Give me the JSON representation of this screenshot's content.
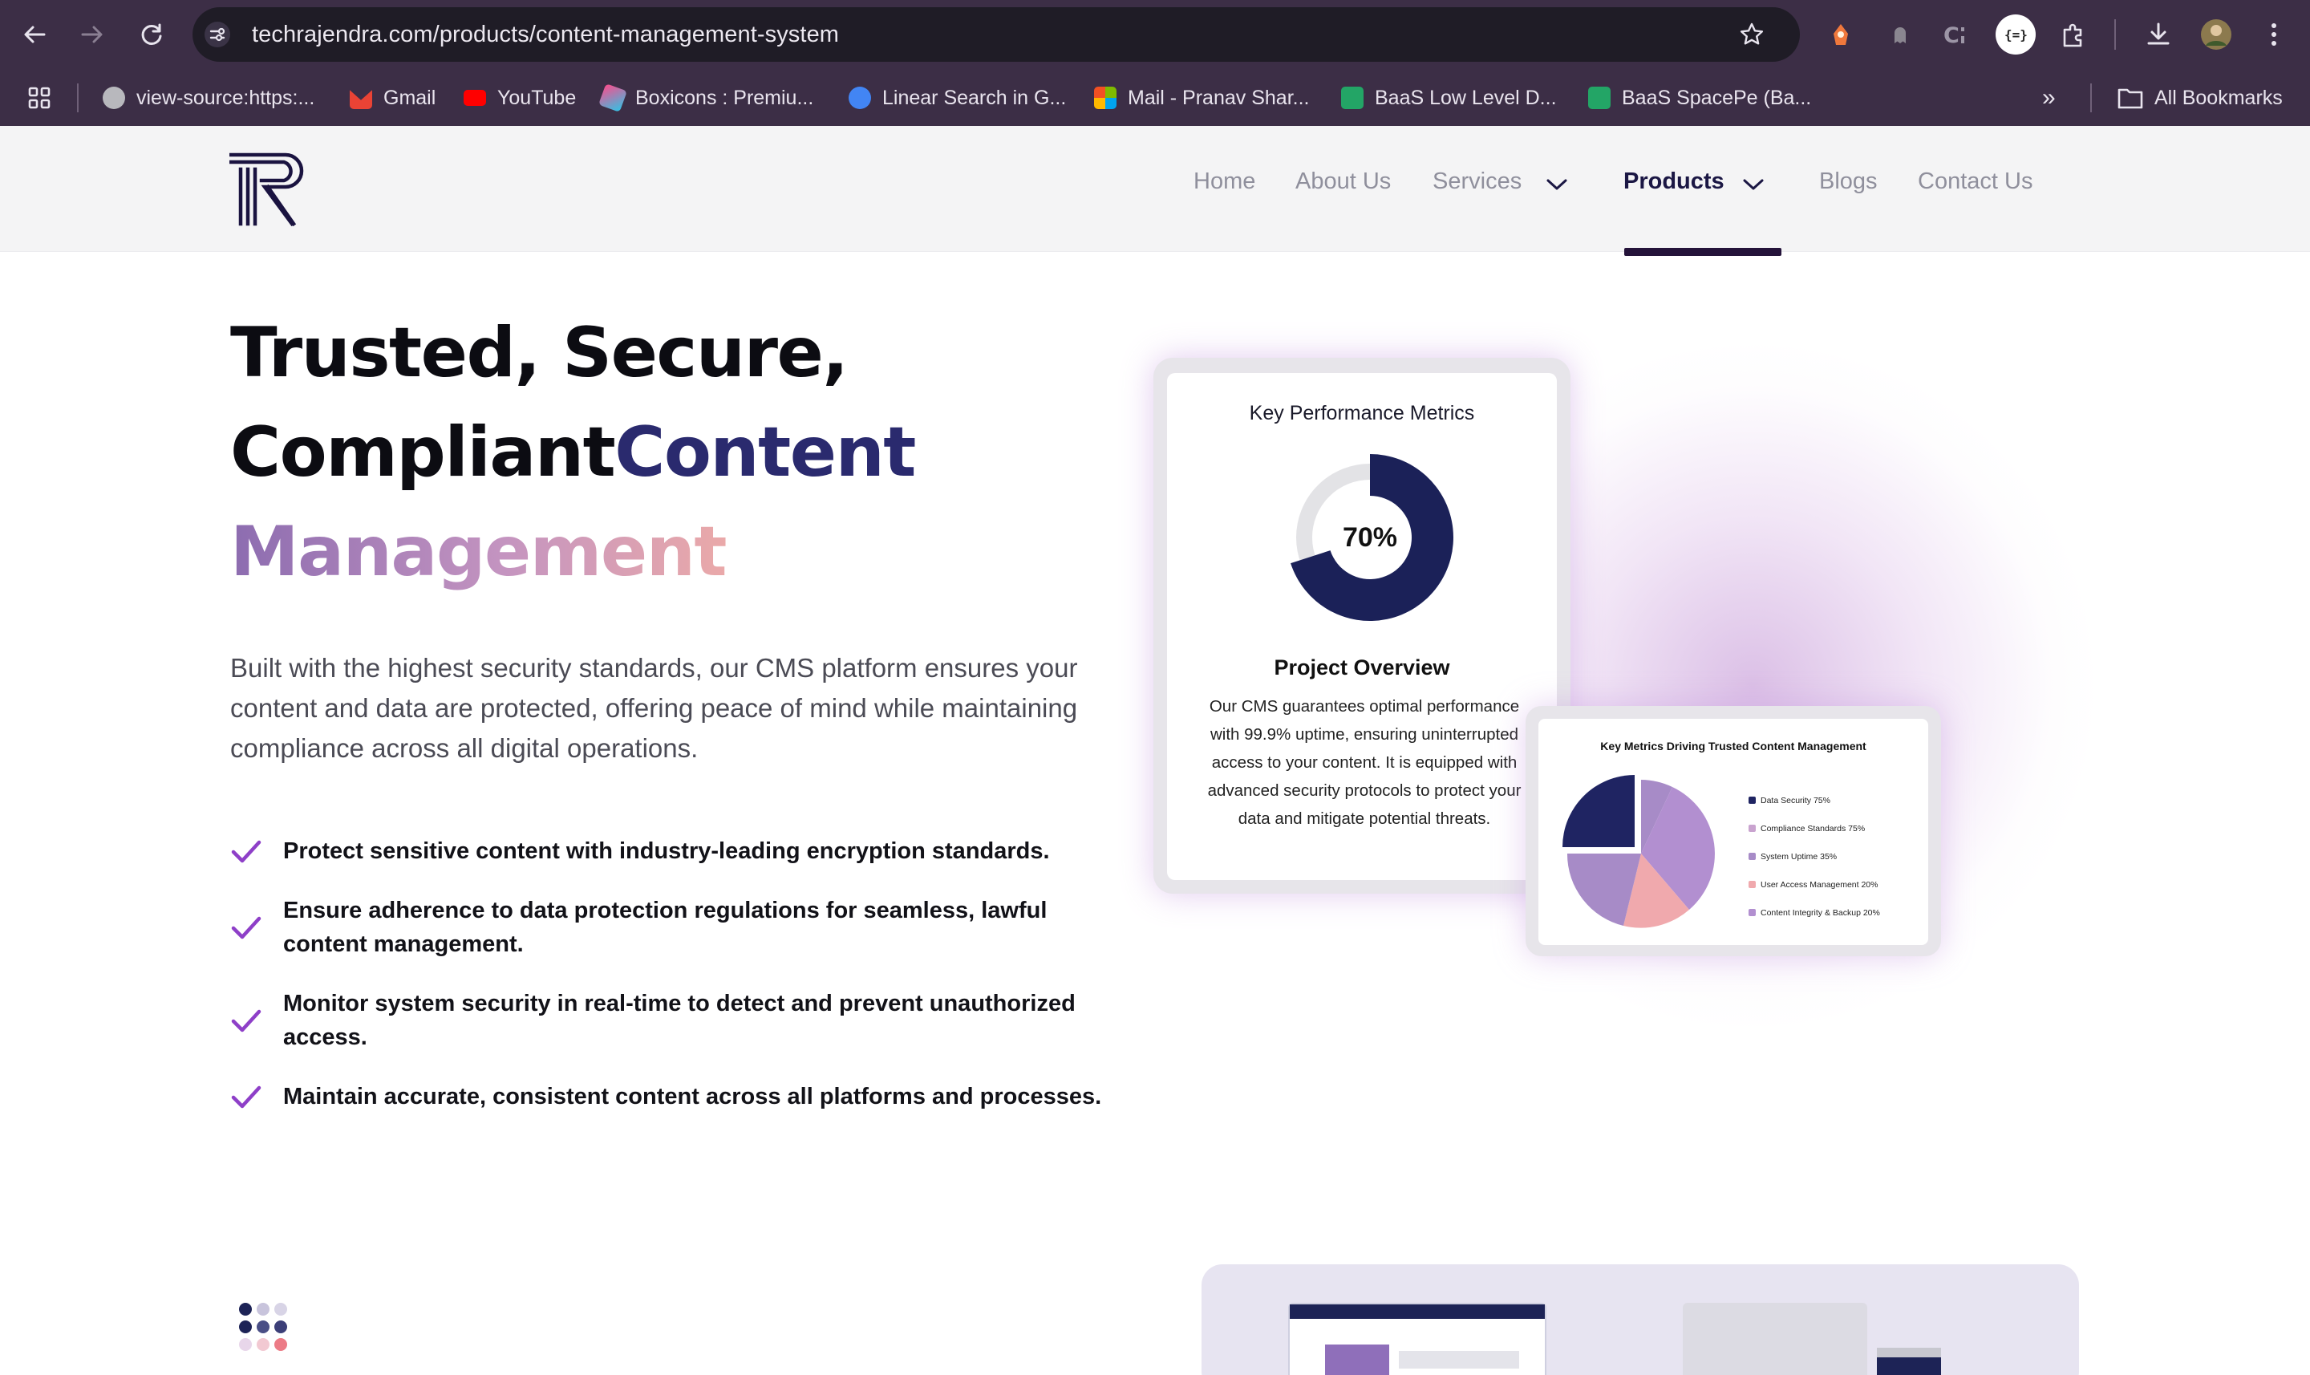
{
  "browser": {
    "url": "techrajendra.com/products/content-management-system",
    "bookmarks": [
      {
        "label": "view-source:https:...",
        "color": "#c8c8c8"
      },
      {
        "label": "Gmail",
        "color": "#ea4335"
      },
      {
        "label": "YouTube",
        "color": "#ff0000"
      },
      {
        "label": "Boxicons : Premiu...",
        "color": "#2ec4e6"
      },
      {
        "label": "Linear Search in G...",
        "color": "#4285f4"
      },
      {
        "label": "Mail - Pranav Shar...",
        "color": "#f25022"
      },
      {
        "label": "BaaS Low Level D...",
        "color": "#23a566"
      },
      {
        "label": "BaaS SpacePe (Ba...",
        "color": "#23a566"
      }
    ],
    "all_bookmarks": "All Bookmarks"
  },
  "nav": {
    "items": [
      "Home",
      "About Us",
      "Services",
      "Products",
      "Blogs",
      "Contact Us"
    ],
    "active": "Products"
  },
  "hero": {
    "title_line1": "Trusted, Secure,",
    "title_line2_a": "Compliant",
    "title_line2_b": "Content",
    "title_line3": "Management",
    "description": "Built with the highest security standards, our CMS platform ensures your content and data are protected, offering peace of mind while maintaining compliance across all digital operations.",
    "features": [
      "Protect sensitive content with industry-leading encryption standards.",
      "Ensure adherence to data protection regulations for seamless, lawful content management.",
      "Monitor system security in real-time to detect and prevent unauthorized access.",
      "Maintain accurate, consistent content across all platforms and processes."
    ]
  },
  "kpi_card": {
    "title": "Key Performance Metrics",
    "percent_label": "70%",
    "percent_value": 70,
    "overview_title": "Project Overview",
    "overview_text": "Our CMS guarantees optimal performance with 99.9% uptime, ensuring uninterrupted access to your content. It is equipped with advanced security protocols to protect your data and mitigate potential threats."
  },
  "metrics_card": {
    "title": "Key Metrics Driving Trusted Content Management",
    "legend": [
      {
        "label": "Data Security 75%",
        "color": "#1f2462"
      },
      {
        "label": "Compliance Standards 75%",
        "color": "#c9a3cf"
      },
      {
        "label": "System Uptime 35%",
        "color": "#a78bc7"
      },
      {
        "label": "User Access Management 20%",
        "color": "#f0a9ad"
      },
      {
        "label": "Content Integrity & Backup 20%",
        "color": "#b28fd0"
      }
    ]
  },
  "colors": {
    "accent_dark": "#24133a",
    "check": "#8e3fc8",
    "navy": "#1d2356"
  }
}
